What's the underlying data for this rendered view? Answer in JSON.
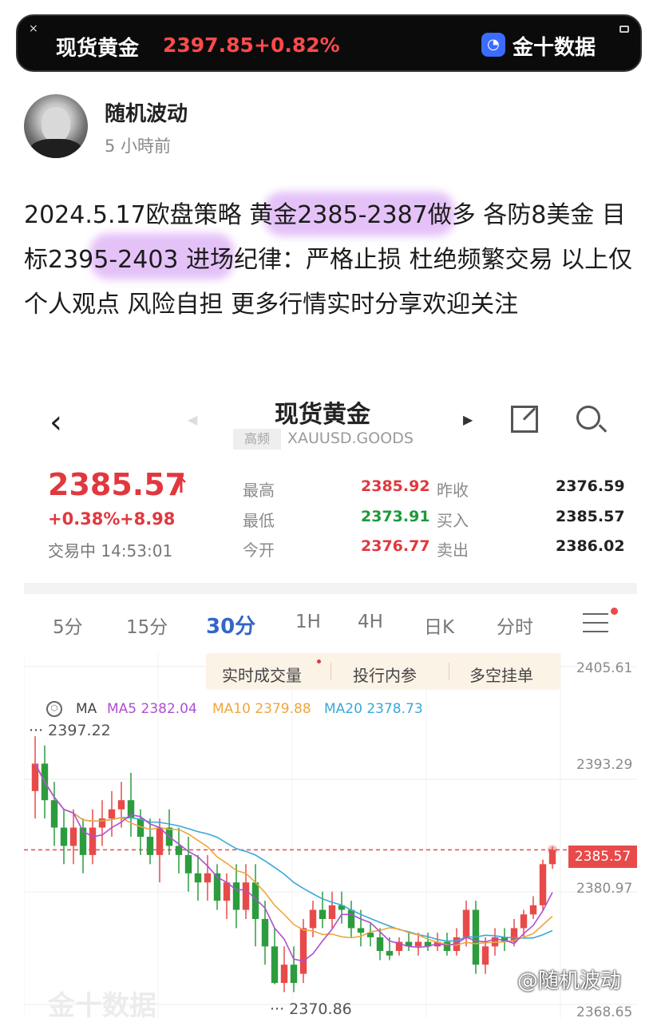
{
  "ticker": {
    "close_label": "×",
    "name": "现货黄金",
    "price": "2397.85",
    "change": "+0.82%",
    "brand": "金十数据"
  },
  "author": {
    "name": "随机波动",
    "time": "5 小時前"
  },
  "post": {
    "text": "2024.5.17欧盘策略 黄金2385-2387做多 各防8美金 目标2395-2403 进场纪律：严格止损 杜绝频繁交易 以上仅个人观点 风险自担 更多行情实时分享欢迎关注"
  },
  "quote": {
    "title": "现货黄金",
    "badge": "高频",
    "symbol": "XAUUSD.GOODS",
    "price": "2385.57",
    "change_pct": "+0.38%",
    "change_abs": "+8.98",
    "status": "交易中 14:53:01",
    "stats": [
      {
        "label": "最高",
        "value": "2385.92",
        "color": "#e0383e"
      },
      {
        "label": "最低",
        "value": "2373.91",
        "color": "#1e9a3a"
      },
      {
        "label": "今开",
        "value": "2376.77",
        "color": "#e0383e"
      },
      {
        "label": "昨收",
        "value": "2376.59",
        "color": "#222222"
      },
      {
        "label": "买入",
        "value": "2385.57",
        "color": "#222222"
      },
      {
        "label": "卖出",
        "value": "2386.02",
        "color": "#222222"
      }
    ]
  },
  "periods": [
    "5分",
    "15分",
    "30分",
    "1H",
    "4H",
    "日K",
    "分时"
  ],
  "active_period": "30分",
  "popup": [
    "实时成交量",
    "投行内参",
    "多空挂单"
  ],
  "ma": {
    "label": "MA",
    "ma5": "MA5 2382.04",
    "ma10": "MA10 2379.88",
    "ma20": "MA20 2378.73",
    "colors": {
      "ma5": "#b04fd1",
      "ma10": "#f0a63c",
      "ma20": "#3aa8d8"
    }
  },
  "chart_data": {
    "type": "candlestick",
    "y_ticks": [
      "2405.61",
      "2393.29",
      "2380.97",
      "2368.65"
    ],
    "current_price": "2385.57",
    "high_mark": "2397.22",
    "low_mark": "2370.86",
    "ylim": [
      2368.65,
      2405.61
    ],
    "up_color": "#e84a4a",
    "down_color": "#2c9c3e",
    "candles": [
      {
        "o": 2392,
        "c": 2395,
        "h": 2398,
        "l": 2389
      },
      {
        "o": 2395,
        "c": 2391,
        "h": 2397,
        "l": 2389
      },
      {
        "o": 2391,
        "c": 2388,
        "h": 2393,
        "l": 2386
      },
      {
        "o": 2388,
        "c": 2386,
        "h": 2390,
        "l": 2384
      },
      {
        "o": 2386,
        "c": 2388,
        "h": 2390,
        "l": 2384
      },
      {
        "o": 2388,
        "c": 2385,
        "h": 2389,
        "l": 2383
      },
      {
        "o": 2385,
        "c": 2388,
        "h": 2390,
        "l": 2384
      },
      {
        "o": 2388,
        "c": 2389,
        "h": 2391,
        "l": 2386
      },
      {
        "o": 2389,
        "c": 2390,
        "h": 2392,
        "l": 2387
      },
      {
        "o": 2390,
        "c": 2391,
        "h": 2393,
        "l": 2388
      },
      {
        "o": 2391,
        "c": 2389,
        "h": 2394,
        "l": 2387
      },
      {
        "o": 2389,
        "c": 2387,
        "h": 2390,
        "l": 2385
      },
      {
        "o": 2387,
        "c": 2385,
        "h": 2389,
        "l": 2384
      },
      {
        "o": 2385,
        "c": 2388,
        "h": 2389,
        "l": 2382
      },
      {
        "o": 2388,
        "c": 2386,
        "h": 2390,
        "l": 2385
      },
      {
        "o": 2386,
        "c": 2385,
        "h": 2388,
        "l": 2383
      },
      {
        "o": 2385,
        "c": 2383,
        "h": 2387,
        "l": 2381
      },
      {
        "o": 2383,
        "c": 2382,
        "h": 2385,
        "l": 2380
      },
      {
        "o": 2382,
        "c": 2383,
        "h": 2385,
        "l": 2380
      },
      {
        "o": 2383,
        "c": 2380,
        "h": 2384,
        "l": 2379
      },
      {
        "o": 2380,
        "c": 2382,
        "h": 2383,
        "l": 2378
      },
      {
        "o": 2382,
        "c": 2379,
        "h": 2384,
        "l": 2377
      },
      {
        "o": 2379,
        "c": 2382,
        "h": 2384,
        "l": 2378
      },
      {
        "o": 2382,
        "c": 2378,
        "h": 2384,
        "l": 2375
      },
      {
        "o": 2378,
        "c": 2375,
        "h": 2380,
        "l": 2373
      },
      {
        "o": 2375,
        "c": 2371,
        "h": 2377,
        "l": 2370.86
      },
      {
        "o": 2371,
        "c": 2373,
        "h": 2375,
        "l": 2370
      },
      {
        "o": 2373,
        "c": 2371,
        "h": 2375,
        "l": 2370
      },
      {
        "o": 2372,
        "c": 2377,
        "h": 2378,
        "l": 2371
      },
      {
        "o": 2377,
        "c": 2379,
        "h": 2380,
        "l": 2376
      },
      {
        "o": 2379,
        "c": 2378,
        "h": 2381,
        "l": 2377
      },
      {
        "o": 2378,
        "c": 2379.5,
        "h": 2381,
        "l": 2377
      },
      {
        "o": 2379.5,
        "c": 2379,
        "h": 2381,
        "l": 2377.5
      },
      {
        "o": 2379,
        "c": 2377,
        "h": 2380,
        "l": 2376
      },
      {
        "o": 2377,
        "c": 2376.5,
        "h": 2379,
        "l": 2375
      },
      {
        "o": 2376.5,
        "c": 2376,
        "h": 2377.5,
        "l": 2375
      },
      {
        "o": 2376,
        "c": 2374.5,
        "h": 2377,
        "l": 2373.5
      },
      {
        "o": 2374.5,
        "c": 2374,
        "h": 2376,
        "l": 2373.5
      },
      {
        "o": 2374.5,
        "c": 2375.5,
        "h": 2376,
        "l": 2374
      },
      {
        "o": 2375.5,
        "c": 2375,
        "h": 2376.5,
        "l": 2374.5
      },
      {
        "o": 2375,
        "c": 2375.5,
        "h": 2376.5,
        "l": 2374
      },
      {
        "o": 2375.5,
        "c": 2375,
        "h": 2376.5,
        "l": 2374.5
      },
      {
        "o": 2375,
        "c": 2375.5,
        "h": 2376.5,
        "l": 2374.5
      },
      {
        "o": 2375.5,
        "c": 2374.5,
        "h": 2376.5,
        "l": 2374
      },
      {
        "o": 2374.5,
        "c": 2376,
        "h": 2377,
        "l": 2374
      },
      {
        "o": 2376,
        "c": 2379,
        "h": 2380,
        "l": 2375
      },
      {
        "o": 2379,
        "c": 2373,
        "h": 2380,
        "l": 2372
      },
      {
        "o": 2373,
        "c": 2375,
        "h": 2376,
        "l": 2372
      },
      {
        "o": 2375,
        "c": 2376,
        "h": 2377,
        "l": 2374
      },
      {
        "o": 2376,
        "c": 2375.5,
        "h": 2377,
        "l": 2374.5
      },
      {
        "o": 2375.5,
        "c": 2377,
        "h": 2378,
        "l": 2375
      },
      {
        "o": 2377,
        "c": 2378.5,
        "h": 2379,
        "l": 2376
      },
      {
        "o": 2378.5,
        "c": 2379.5,
        "h": 2380.5,
        "l": 2378
      },
      {
        "o": 2379.5,
        "c": 2384,
        "h": 2384.5,
        "l": 2379
      },
      {
        "o": 2384,
        "c": 2385.57,
        "h": 2385.92,
        "l": 2383.5
      }
    ]
  },
  "watermark_author": "@随机波动"
}
